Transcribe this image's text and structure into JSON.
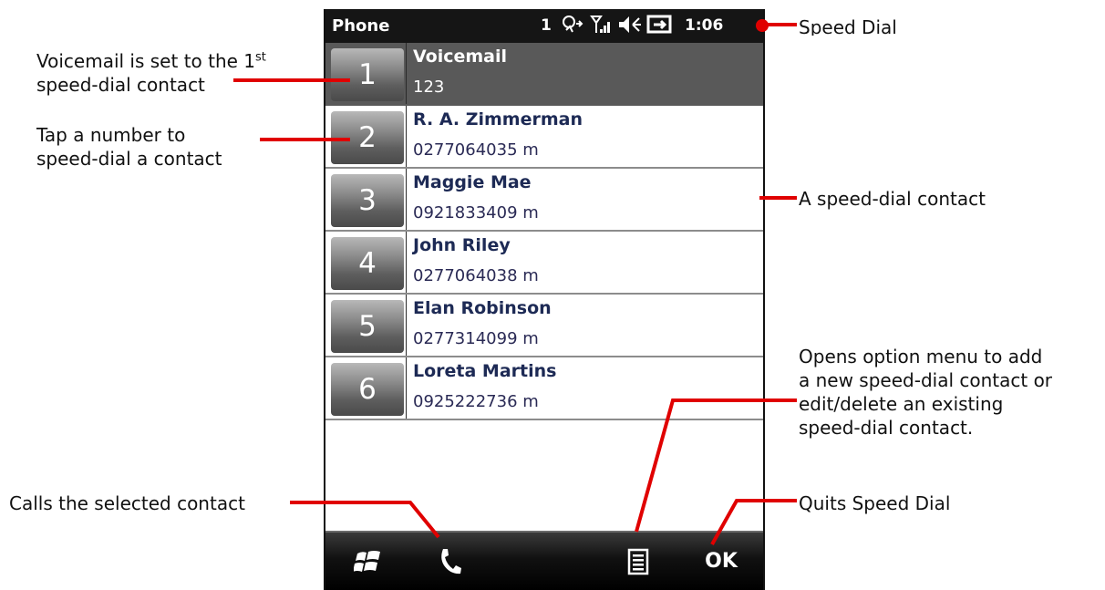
{
  "phone": {
    "status": {
      "title": "Phone",
      "indicator": "1",
      "time": "1:06",
      "icons": [
        "connectivity-icon",
        "signal-icon",
        "speaker-icon",
        "battery-icon"
      ]
    },
    "contacts": [
      {
        "slot": "1",
        "name": "Voicemail",
        "number": "123",
        "selected": true
      },
      {
        "slot": "2",
        "name": "R. A. Zimmerman",
        "number": "0277064035 m"
      },
      {
        "slot": "3",
        "name": "Maggie Mae",
        "number": "0921833409 m"
      },
      {
        "slot": "4",
        "name": "John Riley",
        "number": "0277064038 m"
      },
      {
        "slot": "5",
        "name": "Elan Robinson",
        "number": "0277314099 m"
      },
      {
        "slot": "6",
        "name": "Loreta Martins",
        "number": "0925222736 m"
      }
    ],
    "softkeys": {
      "start": "windows-start-icon",
      "call": "phone-handset-icon",
      "menu": "menu-icon",
      "ok": "OK"
    }
  },
  "annotations": {
    "voicemail": {
      "line1": "Voicemail is set to the 1",
      "sup": "st",
      "line2": "speed-dial contact"
    },
    "tap": {
      "line1": "Tap a number to",
      "line2": "speed-dial a contact"
    },
    "calls": "Calls the selected contact",
    "speed_dial": "Speed Dial",
    "contact": "A speed-dial contact",
    "menu": {
      "line1": "Opens option menu to add",
      "line2": "a new speed-dial contact or",
      "line3": "edit/delete an existing",
      "line4": "speed-dial contact."
    },
    "quits": "Quits Speed Dial"
  },
  "colors": {
    "callout": "#e00000",
    "selected_row": "#595959",
    "name_text": "#1d2a55"
  }
}
